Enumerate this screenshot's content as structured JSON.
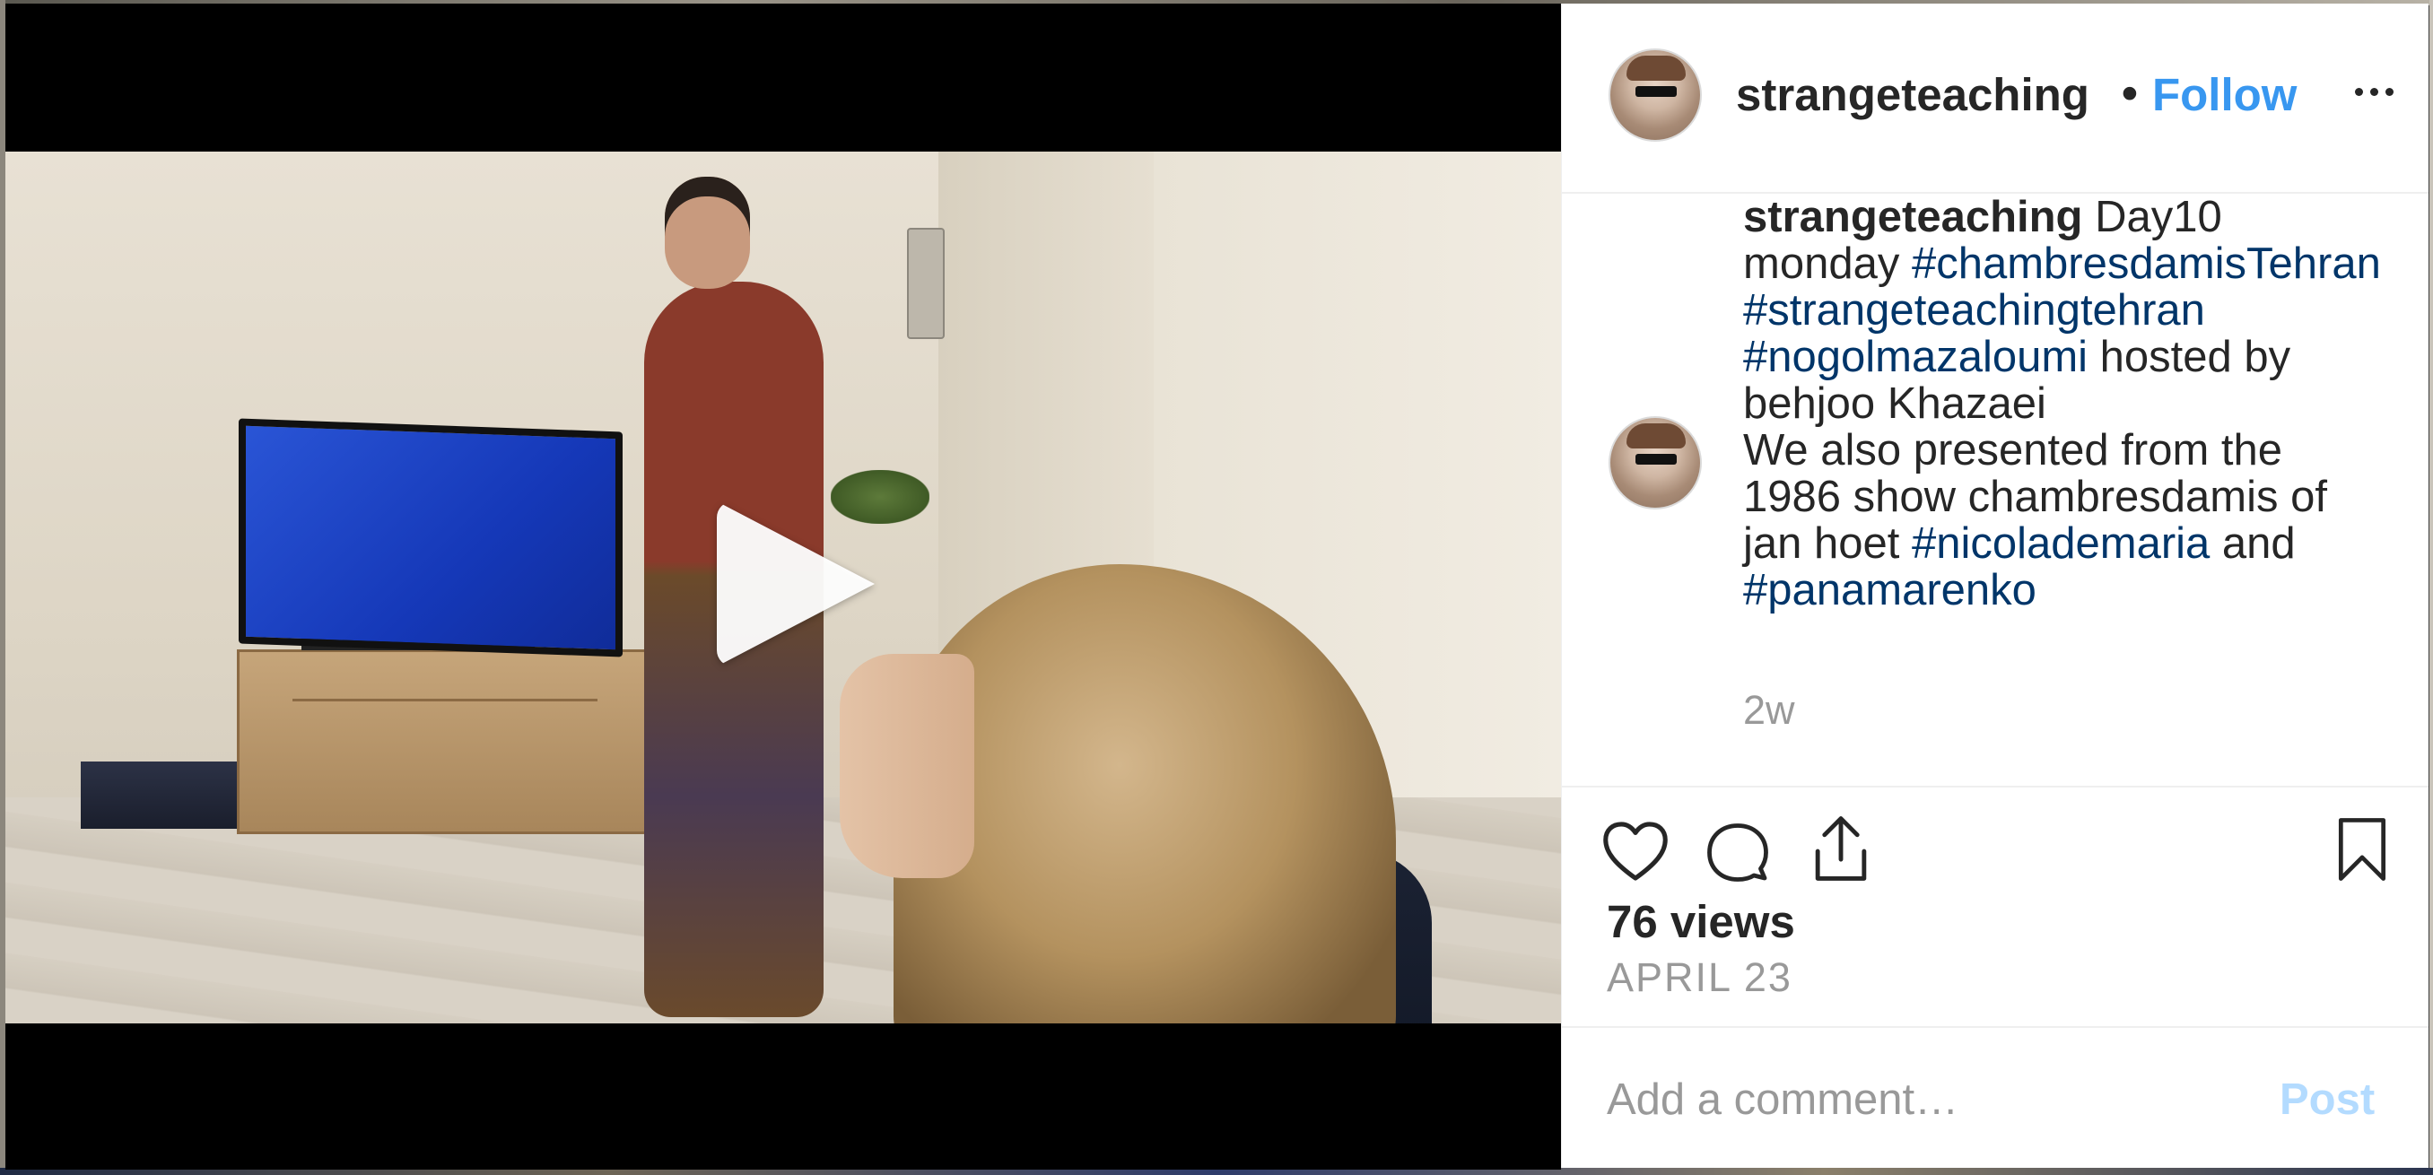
{
  "post": {
    "username": "strangeteaching",
    "separator": "•",
    "follow_label": "Follow",
    "caption": {
      "username": "strangeteaching",
      "text_1": " Day10 monday ",
      "tag_1": "#chambresdamisTehran",
      "tag_2": "#strangeteachingtehran",
      "tag_3": "#nogolmazaloumi",
      "text_2": " hosted by behjoo Khazaei",
      "text_3": "We also presented from the 1986 show chambresdamis of jan hoet ",
      "tag_4": "#nicolademaria",
      "text_4": " and ",
      "tag_5": "#panamarenko"
    },
    "time_ago": "2w",
    "views": "76 views",
    "date": "APRIL 23"
  },
  "comment": {
    "placeholder": "Add a comment…",
    "post_label": "Post"
  },
  "icons": {
    "more": "more-horizontal-icon",
    "like": "heart-icon",
    "comment": "comment-icon",
    "share": "share-icon",
    "save": "bookmark-icon",
    "play": "play-icon"
  },
  "colors": {
    "link": "#3897f0",
    "hashtag": "#003569",
    "text": "#262626",
    "muted": "#999999",
    "post_disabled": "#b3dbff"
  }
}
